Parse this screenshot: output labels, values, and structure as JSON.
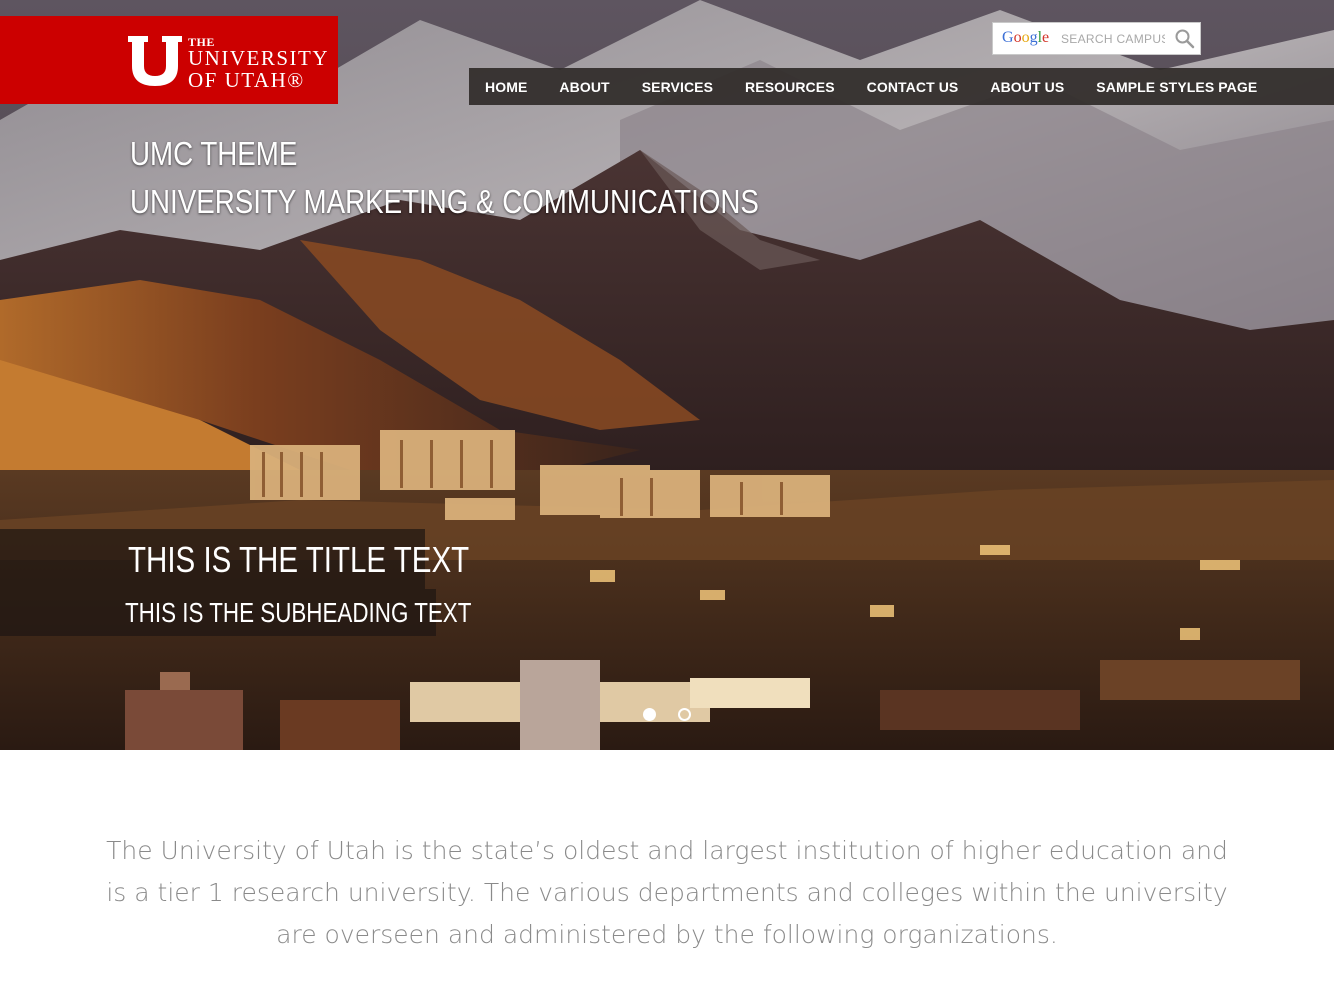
{
  "brand": {
    "the": "THE",
    "line1": "UNIVERSITY",
    "line2": "OF UTAH®",
    "color": "#cc0000"
  },
  "search": {
    "provider_logo": "Google",
    "placeholder": "SEARCH CAMPUS",
    "icon": "magnifier-icon"
  },
  "nav": {
    "items": [
      "HOME",
      "ABOUT",
      "SERVICES",
      "RESOURCES",
      "CONTACT US",
      "ABOUT US",
      "SAMPLE STYLES PAGE"
    ]
  },
  "hero": {
    "line1": "UMC THEME",
    "line2": "UNIVERSITY MARKETING & COMMUNICATIONS",
    "slide_title": "THIS IS THE TITLE TEXT",
    "slide_subheading": "THIS IS THE SUBHEADING TEXT",
    "slides_total": 2,
    "active_slide": 1
  },
  "intro": {
    "text": "The University of Utah is the state’s oldest and largest institution of higher education and is a tier 1 research university. The various departments and colleges within the university are overseen and administered by the following organizations."
  }
}
